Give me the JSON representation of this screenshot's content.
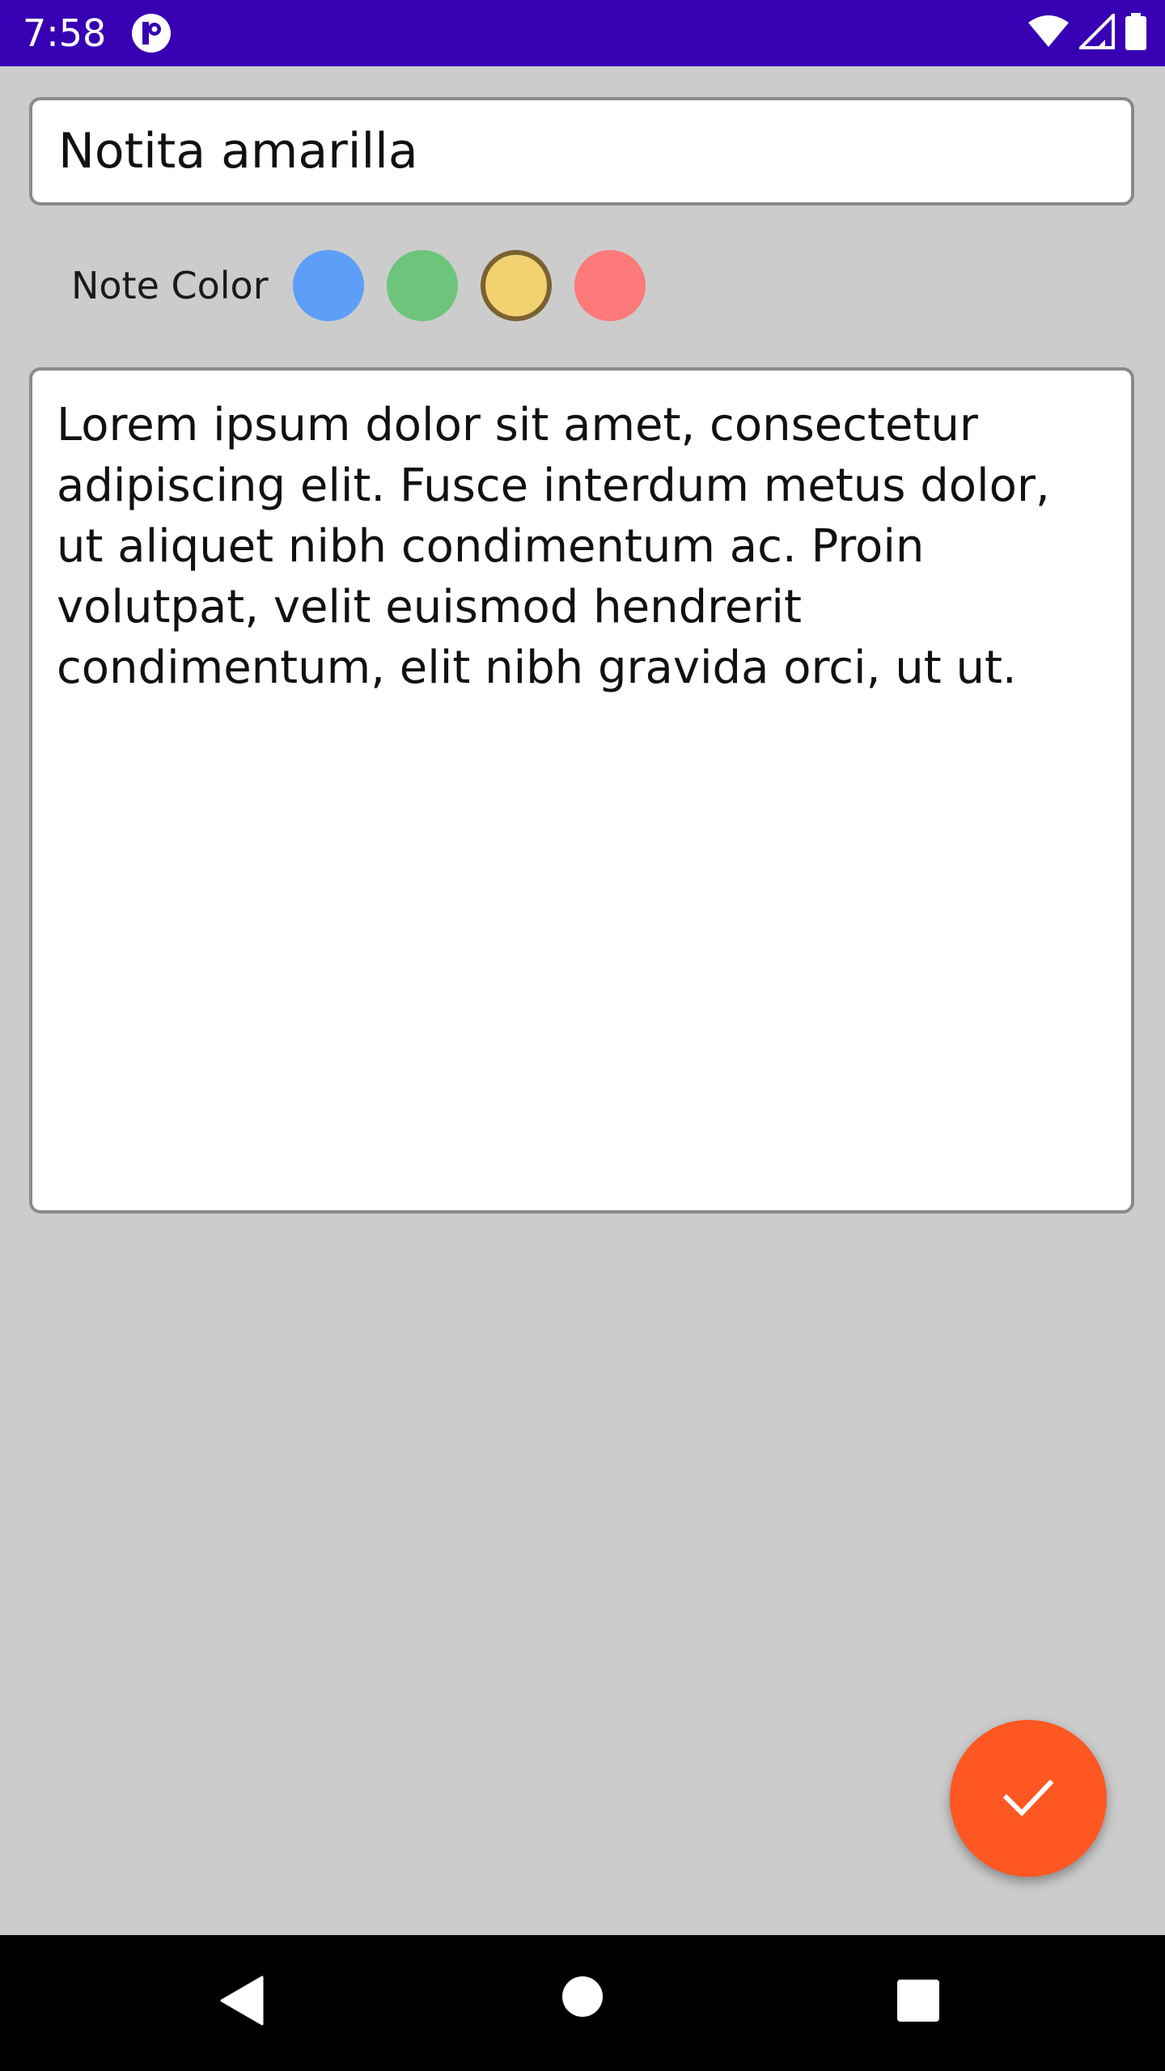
{
  "status_bar": {
    "time": "7:58",
    "background_color": "#3700b3",
    "icons": [
      "app-notification-icon",
      "wifi-icon",
      "cell-signal-icon",
      "battery-icon"
    ]
  },
  "note": {
    "title": "Notita amarilla",
    "body": "Lorem ipsum dolor sit amet, consectetur adipiscing elit. Fusce interdum metus dolor, ut aliquet nibh condimentum ac. Proin volutpat, velit euismod hendrerit condimentum, elit nibh gravida orci, ut ut."
  },
  "color_picker": {
    "label": "Note Color",
    "options": [
      {
        "name": "blue",
        "color": "#5c9ef8",
        "selected": false
      },
      {
        "name": "green",
        "color": "#6cc57b",
        "selected": false
      },
      {
        "name": "yellow",
        "color": "#f2d171",
        "selected": true
      },
      {
        "name": "red",
        "color": "#fc7a7a",
        "selected": false
      }
    ]
  },
  "fab": {
    "icon": "check-icon",
    "color": "#ff5722"
  },
  "nav_bar": {
    "icons": [
      "back-icon",
      "home-icon",
      "recents-icon"
    ]
  }
}
